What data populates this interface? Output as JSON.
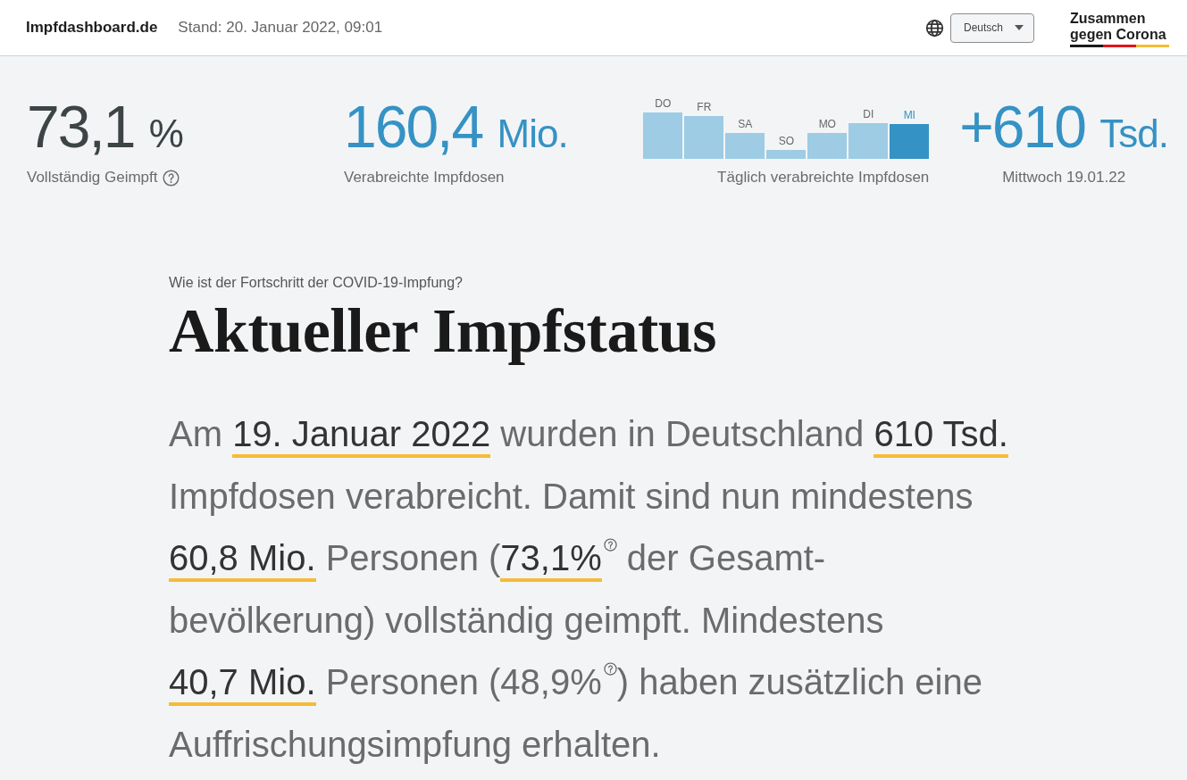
{
  "header": {
    "brand": "Impfdashboard.de",
    "timestamp": "Stand: 20. Januar 2022, 09:01",
    "language": {
      "value": "Deutsch"
    },
    "logo": {
      "lines": [
        "Zusammen",
        "gegen Corona"
      ]
    }
  },
  "stats": [
    {
      "kind": "stat",
      "value": "73,1",
      "unit": "%",
      "label": "Vollständig Geimpft",
      "help": true,
      "color": "#3c4446"
    },
    {
      "kind": "stat",
      "value": "160,4",
      "unit": "Mio.",
      "label": "Verabreichte Impfdosen",
      "help": false,
      "color": "#3592c4"
    },
    {
      "kind": "chart",
      "caption": "Täglich verabreichte Impfdosen",
      "days": [
        {
          "label": "DO",
          "selected": false
        },
        {
          "label": "FR",
          "selected": false
        },
        {
          "label": "SA",
          "selected": false
        },
        {
          "label": "SO",
          "selected": false
        },
        {
          "label": "MO",
          "selected": false
        },
        {
          "label": "DI",
          "selected": false
        },
        {
          "label": "MI",
          "selected": true
        }
      ]
    },
    {
      "kind": "stat",
      "value": "+610",
      "unit": "Tsd.",
      "label": "Mittwoch 19.01.22",
      "help": false,
      "color": "#3592c4"
    }
  ],
  "section": {
    "eyebrow": "Wie ist der Fortschritt der COVID-19-Impfung?",
    "title": "Aktueller Impfstatus",
    "summary": [
      {
        "text": "Am ",
        "highlight": false,
        "help": false
      },
      {
        "text": "19. Januar 2022",
        "highlight": true,
        "help": false
      },
      {
        "text": " wurden in Deutschland ",
        "highlight": false,
        "help": false
      },
      {
        "text": "610 Tsd.",
        "highlight": true,
        "help": false
      },
      {
        "text": " Impfdosen verabreicht. Damit sind nun mindestens ",
        "highlight": false,
        "help": false
      },
      {
        "text": "60,8 Mio.",
        "highlight": true,
        "help": false
      },
      {
        "text": " Personen (",
        "highlight": false,
        "help": false
      },
      {
        "text": "73,1%",
        "highlight": true,
        "help": true
      },
      {
        "text": " der Gesamt-bevölkerung) vollständig geimpft. Mindestens ",
        "highlight": false,
        "help": false
      },
      {
        "text": "40,7 Mio.",
        "highlight": true,
        "help": false
      },
      {
        "text": " Personen (48,9%",
        "highlight": false,
        "help": true
      },
      {
        "text": ") haben zusätzlich eine Auffrischungsimpfung erhalten.",
        "highlight": false,
        "help": false
      }
    ]
  }
}
